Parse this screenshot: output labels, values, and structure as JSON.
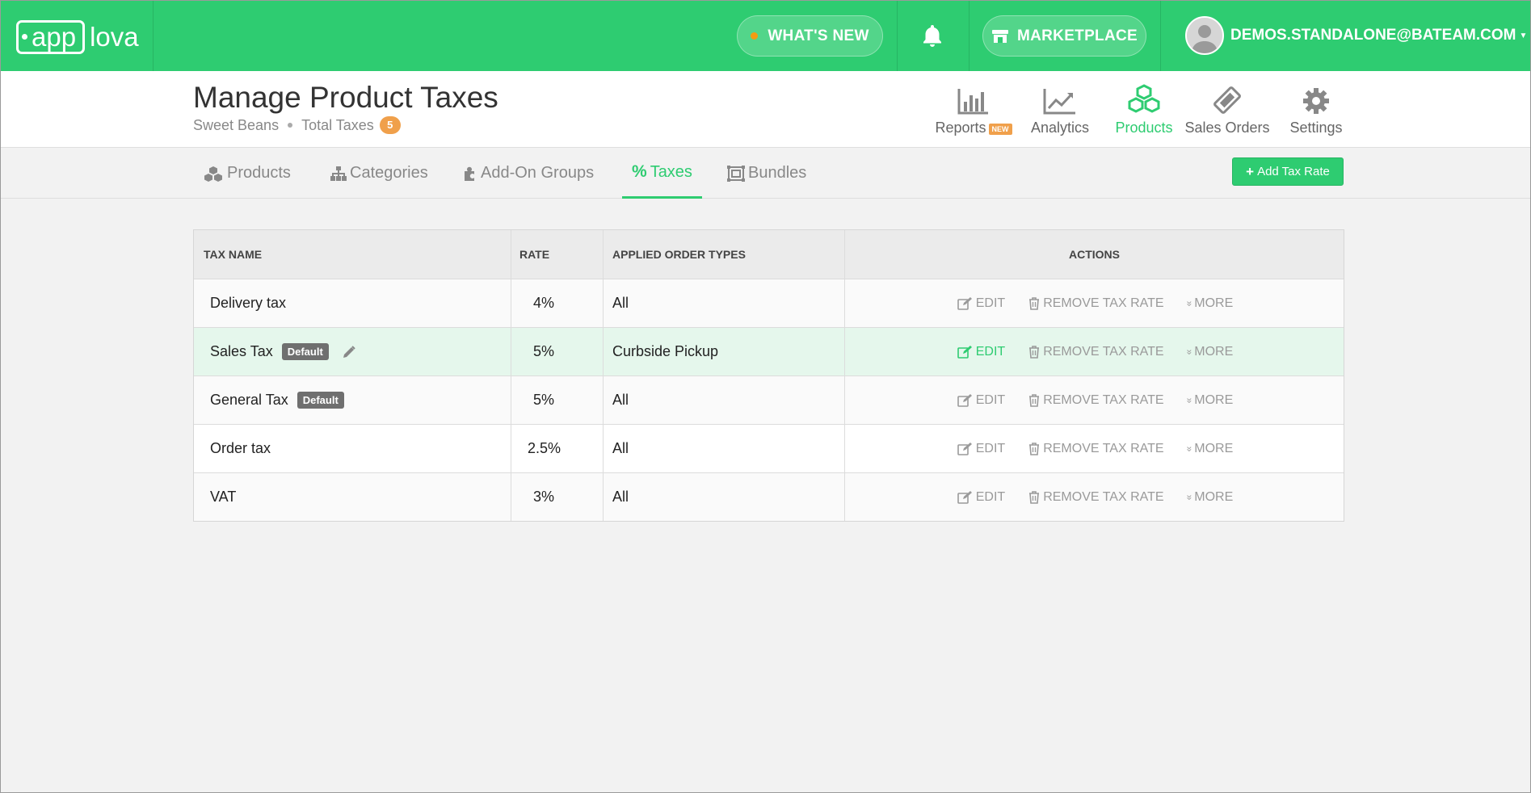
{
  "brand": {
    "logo_left": "app",
    "logo_right": "lova"
  },
  "topbar": {
    "whats_new": "WHAT'S NEW",
    "marketplace": "MARKETPLACE",
    "user_email": "DEMOS.STANDALONE@BATEAM.COM",
    "accent": "#2ecc71"
  },
  "page": {
    "title": "Manage Product Taxes",
    "store": "Sweet Beans",
    "total_label": "Total Taxes",
    "total_count": "5"
  },
  "mainnav": [
    {
      "label": "Reports",
      "badge": "NEW",
      "icon": "bar-chart-icon"
    },
    {
      "label": "Analytics",
      "icon": "line-chart-icon"
    },
    {
      "label": "Products",
      "icon": "cubes-icon",
      "active": true
    },
    {
      "label": "Sales Orders",
      "icon": "ticket-icon"
    },
    {
      "label": "Settings",
      "icon": "gear-icon"
    }
  ],
  "tabs": [
    {
      "label": "Products",
      "icon": "cubes-icon"
    },
    {
      "label": "Categories",
      "icon": "sitemap-icon"
    },
    {
      "label": "Add-On Groups",
      "icon": "puzzle-icon"
    },
    {
      "label": "Taxes",
      "icon": "percent-icon",
      "active": true
    },
    {
      "label": "Bundles",
      "icon": "bundle-icon"
    }
  ],
  "add_button": "Add Tax Rate",
  "table": {
    "headers": [
      "TAX NAME",
      "RATE",
      "APPLIED ORDER TYPES",
      "ACTIONS"
    ],
    "actions": {
      "edit": "EDIT",
      "remove": "REMOVE TAX RATE",
      "more": "MORE"
    },
    "rows": [
      {
        "name": "Delivery tax",
        "rate": "4%",
        "types": "All"
      },
      {
        "name": "Sales Tax",
        "default": "Default",
        "rate": "5%",
        "types": "Curbside Pickup"
      },
      {
        "name": "General Tax",
        "default": "Default",
        "rate": "5%",
        "types": "All"
      },
      {
        "name": "Order tax",
        "rate": "2.5%",
        "types": "All"
      },
      {
        "name": "VAT",
        "rate": "3%",
        "types": "All"
      }
    ]
  }
}
